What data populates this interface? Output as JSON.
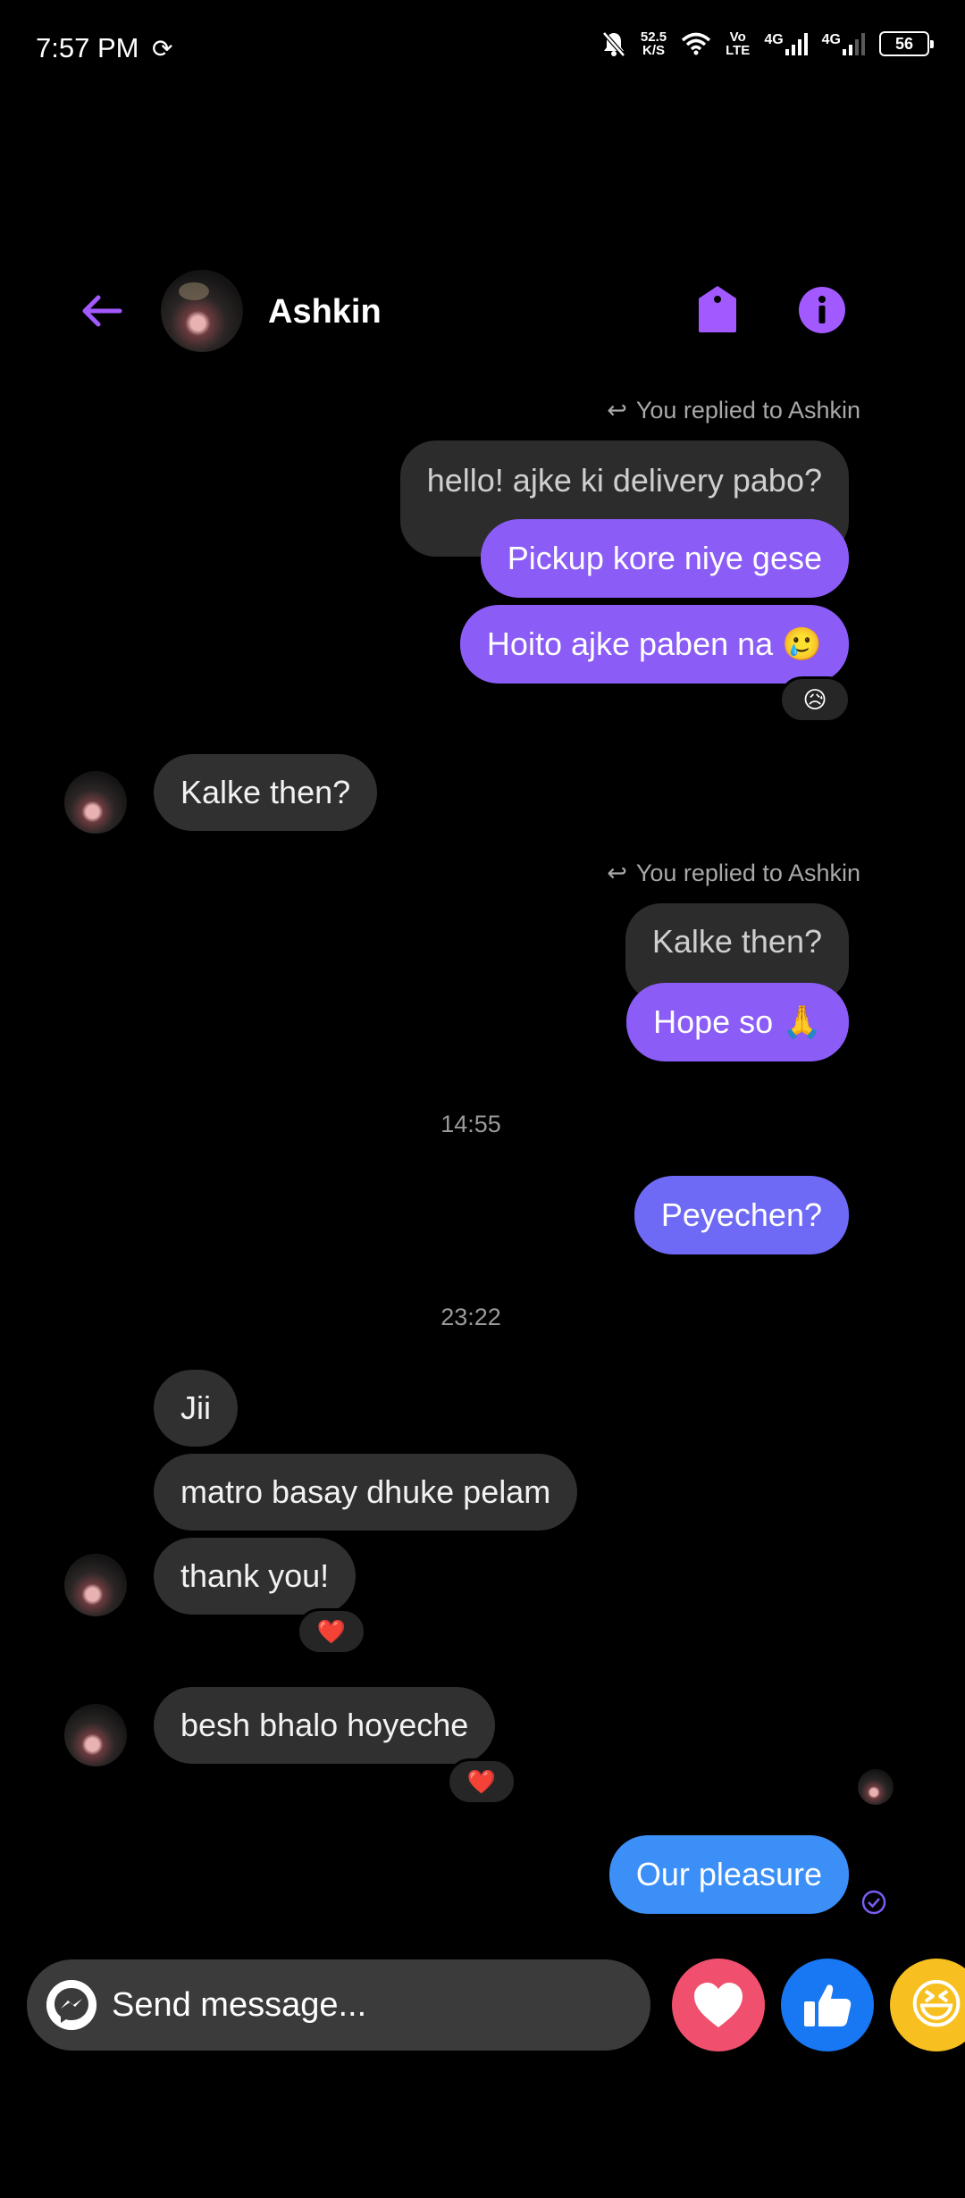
{
  "status_bar": {
    "time": "7:57 PM",
    "speed_value": "52.5",
    "speed_unit": "K/S",
    "volte_top": "Vo",
    "volte_bottom": "LTE",
    "net1": "4G",
    "net2": "4G",
    "battery": "56"
  },
  "header": {
    "contact_name": "Ashkin",
    "accent_color": "#a259ff"
  },
  "chat": {
    "reply_note_1": "You replied to Ashkin",
    "quoted_1": "hello! ajke ki delivery pabo?",
    "out_1": "Pickup kore niye gese",
    "out_2": "Hoito ajke paben na 🥲",
    "reaction_1": "😥",
    "in_1": "Kalke then?",
    "reply_note_2": "You replied to Ashkin",
    "quoted_2": "Kalke then?",
    "out_3": "Hope so 🙏",
    "timestamp_1": "14:55",
    "out_4": "Peyechen?",
    "timestamp_2": "23:22",
    "in_2": "Jii",
    "in_3": "matro basay dhuke pelam",
    "in_4": "thank you!",
    "reaction_2": "❤️",
    "in_5": "besh bhalo hoyeche",
    "reaction_3": "❤️",
    "out_5": "Our pleasure"
  },
  "composer": {
    "placeholder": "Send message..."
  },
  "quick_reactions": {
    "love_color": "#f0506e",
    "like_color": "#1877f2",
    "emoji": "😆"
  }
}
